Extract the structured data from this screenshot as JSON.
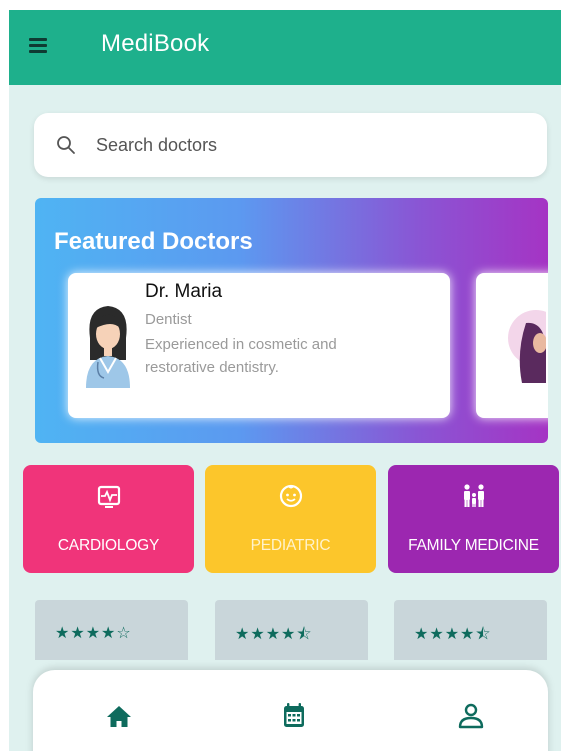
{
  "app": {
    "title": "MediBook"
  },
  "search": {
    "placeholder": "Search doctors"
  },
  "featured": {
    "title": "Featured Doctors",
    "doctors": [
      {
        "name": "Dr. Maria",
        "specialty": "Dentist",
        "description": "Experienced in cosmetic and restorative dentistry."
      }
    ]
  },
  "categories": [
    {
      "label": "CARDIOLOGY",
      "icon": "heart-monitor-icon",
      "color": "#f0347a"
    },
    {
      "label": "PEDIATRIC",
      "icon": "baby-face-icon",
      "color": "#fcc62b"
    },
    {
      "label": "FAMILY MEDICINE",
      "icon": "family-icon",
      "color": "#9c27b0"
    }
  ],
  "ratings": [
    {
      "stars": "★★★★☆",
      "value": 4
    },
    {
      "stars": "★★★★⯪",
      "value": 4.5
    },
    {
      "stars": "★★★★⯪",
      "value": 4.5
    }
  ],
  "nav": {
    "items": [
      "home-icon",
      "calendar-icon",
      "profile-icon"
    ]
  },
  "colors": {
    "primary": "#1eb08c",
    "background": "#dff1ef",
    "accent_icon": "#0e6b5d"
  }
}
